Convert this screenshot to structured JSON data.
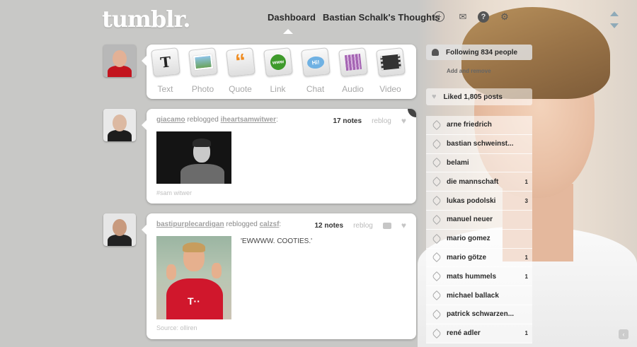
{
  "header": {
    "logo": "tumblr.",
    "nav": {
      "dashboard": "Dashboard",
      "blog_title": "Bastian Schalk's Thoughts"
    },
    "icons": [
      "plus-circle-icon",
      "mail-icon",
      "help-icon",
      "gear-icon"
    ]
  },
  "post_types": [
    {
      "label": "Text",
      "icon": "text-icon",
      "glyph": "T"
    },
    {
      "label": "Photo",
      "icon": "photo-icon",
      "glyph": ""
    },
    {
      "label": "Quote",
      "icon": "quote-icon",
      "glyph": "“"
    },
    {
      "label": "Link",
      "icon": "link-icon",
      "glyph": "www"
    },
    {
      "label": "Chat",
      "icon": "chat-icon",
      "glyph": "Hi!"
    },
    {
      "label": "Audio",
      "icon": "audio-icon",
      "glyph": ""
    },
    {
      "label": "Video",
      "icon": "video-icon",
      "glyph": ""
    }
  ],
  "posts": [
    {
      "user": "giacamo",
      "action": "reblogged",
      "source": "iheartsamwitwer",
      "notes": "17 notes",
      "reblog": "reblog",
      "tag": "#sam witwer"
    },
    {
      "user": "bastipurplecardigan",
      "action": "reblogged",
      "source": "calzsf",
      "notes": "12 notes",
      "reblog": "reblog",
      "caption": "'EWWWW. COOTIES.'",
      "source_line": "Source: olliren",
      "shirt_text": "T··"
    }
  ],
  "sidebar": {
    "following": "Following 834 people",
    "add_remove": "Add and remove",
    "liked": "Liked 1,805 posts",
    "tags": [
      {
        "name": "arne friedrich",
        "count": ""
      },
      {
        "name": "bastian schweinst...",
        "count": ""
      },
      {
        "name": "belami",
        "count": ""
      },
      {
        "name": "die mannschaft",
        "count": "1"
      },
      {
        "name": "lukas podolski",
        "count": "3"
      },
      {
        "name": "manuel neuer",
        "count": ""
      },
      {
        "name": "mario gomez",
        "count": ""
      },
      {
        "name": "mario götze",
        "count": "1"
      },
      {
        "name": "mats hummels",
        "count": "1"
      },
      {
        "name": "michael ballack",
        "count": ""
      },
      {
        "name": "patrick schwarzen...",
        "count": ""
      },
      {
        "name": "rené adler",
        "count": "1"
      }
    ]
  },
  "colors": {
    "background": "#c8c8c6",
    "panel": "#ffffff",
    "jersey_red": "#d0172c"
  }
}
